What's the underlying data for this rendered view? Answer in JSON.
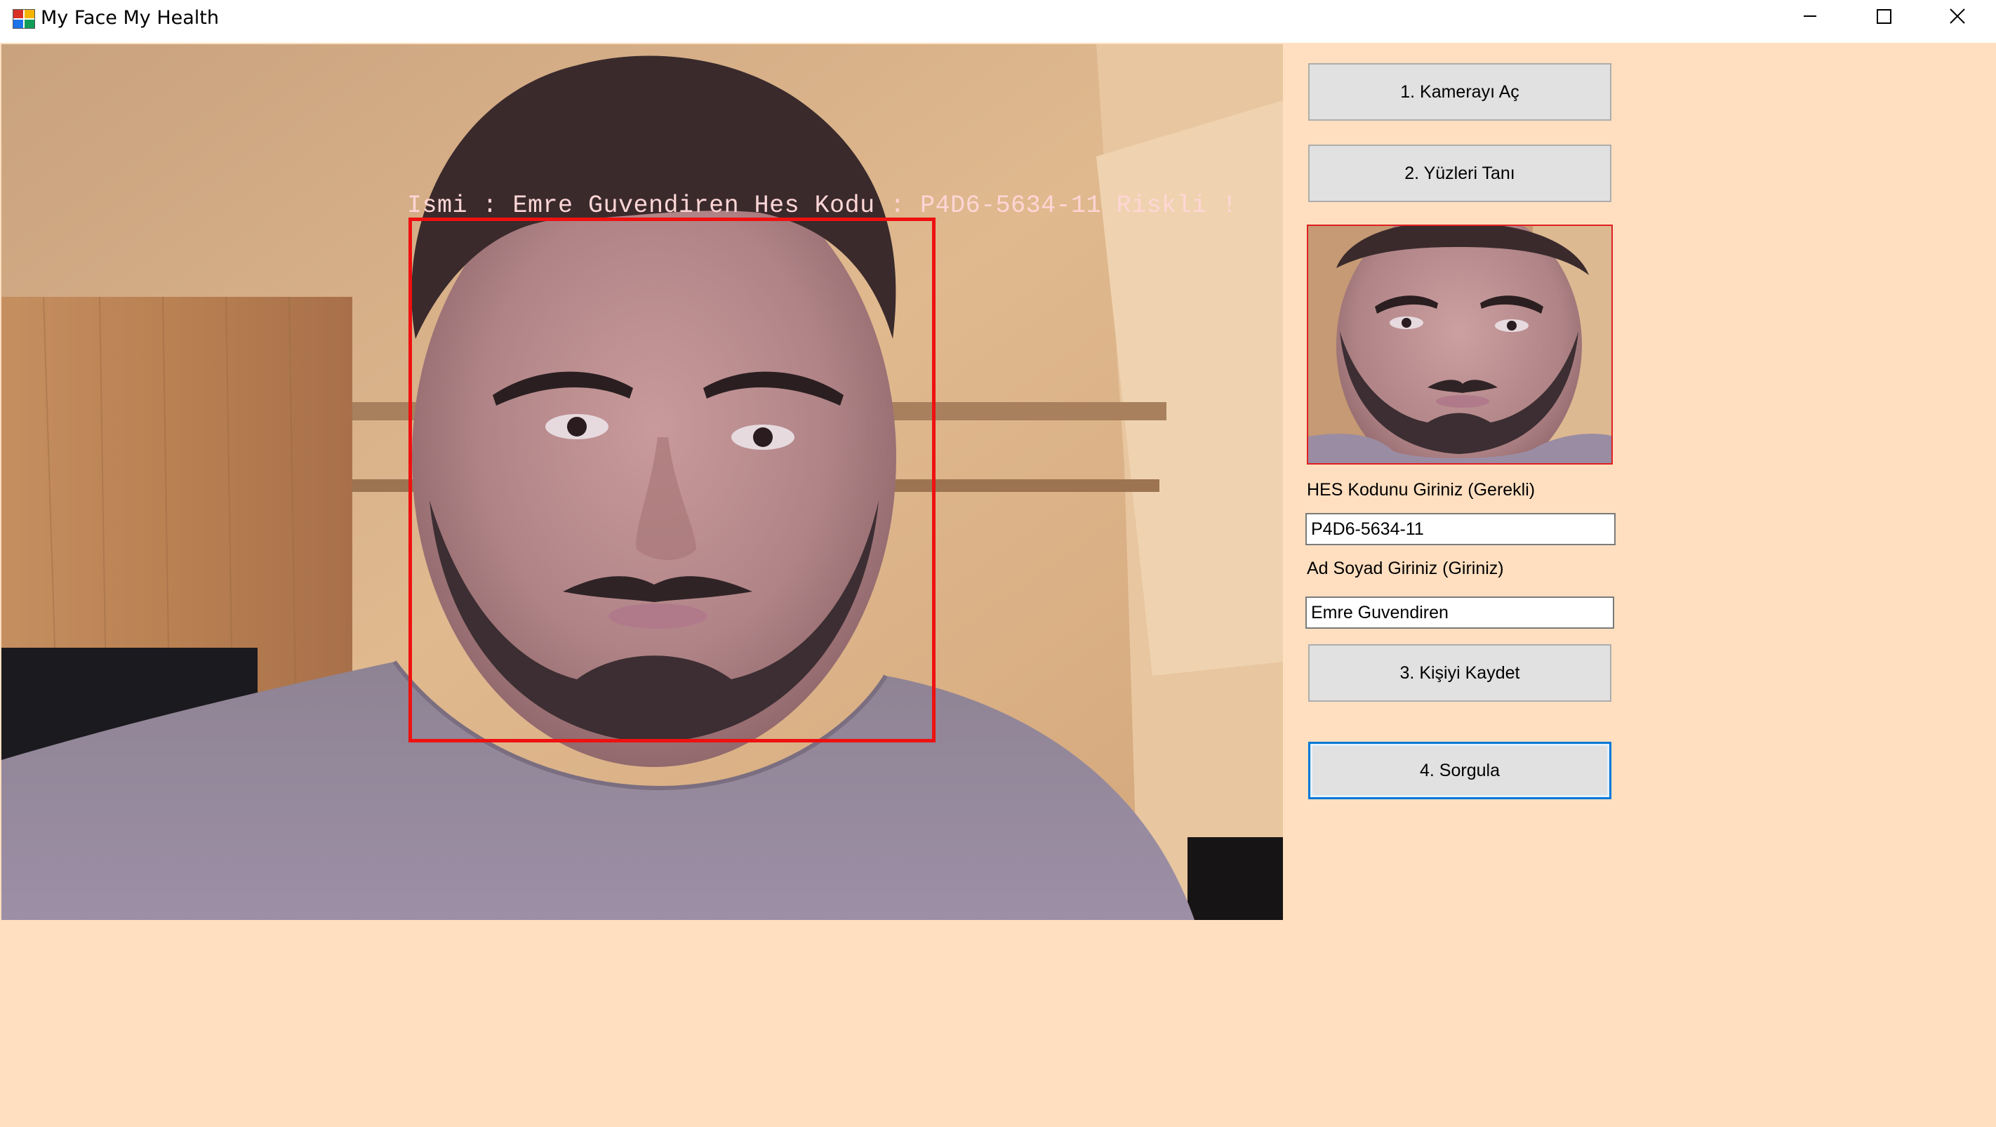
{
  "window": {
    "title": "My Face My Health",
    "icon": "app-icon",
    "controls": [
      "minimize-icon",
      "maximize-icon",
      "close-icon"
    ]
  },
  "camera": {
    "overlay_text": "Ismi : Emre Guvendiren Hes Kodu : P4D6-5634-11 Riskli !",
    "face_box_color": "#ee1111"
  },
  "buttons": {
    "open_camera": "1. Kamerayı Aç",
    "recognize_faces": "2. Yüzleri Tanı",
    "save_person": "3. Kişiyi Kaydet",
    "query": "4. Sorgula"
  },
  "form": {
    "hes_label": "HES Kodunu Giriniz (Gerekli)",
    "hes_value": "P4D6-5634-11",
    "name_label": "Ad Soyad Giriniz (Giriniz)",
    "name_value": "Emre Guvendiren"
  },
  "colors": {
    "background": "#ffdfc0",
    "focus_border": "#0078d7",
    "button_face": "#e1e1e1"
  }
}
